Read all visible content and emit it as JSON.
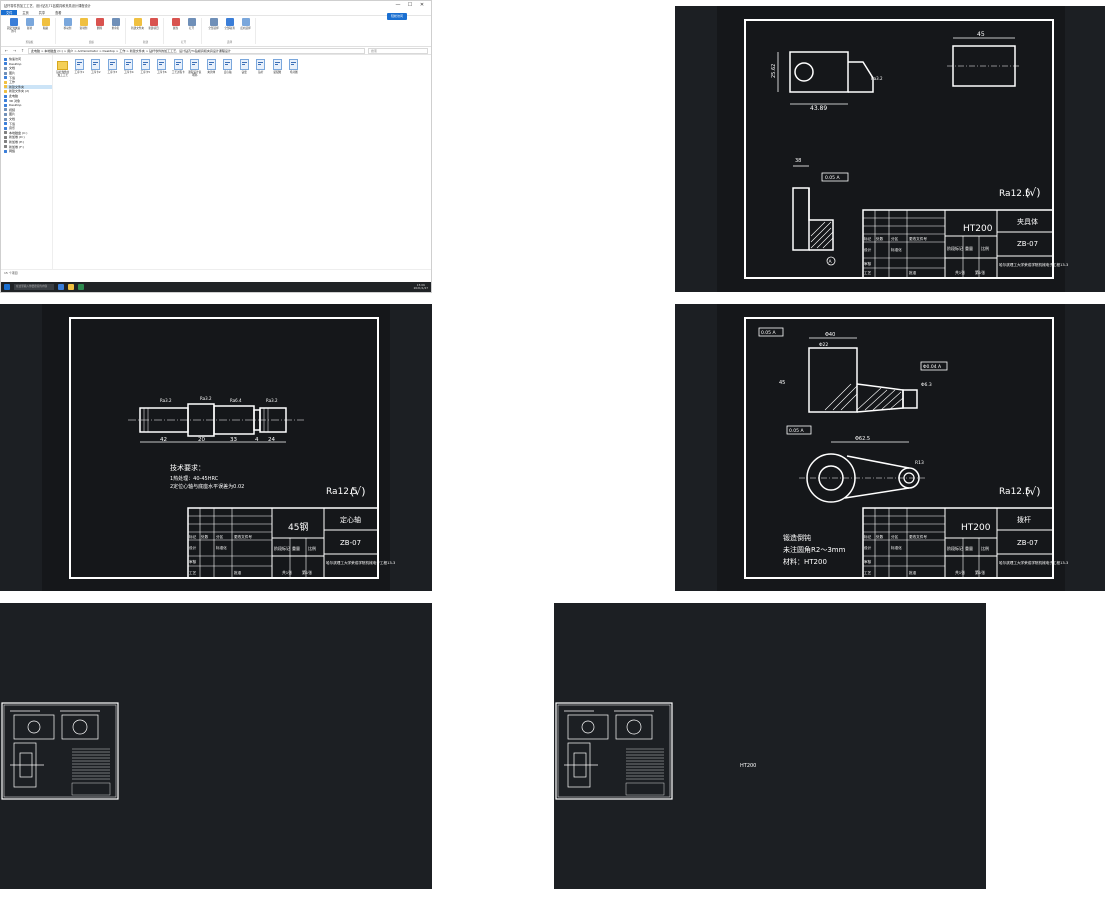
{
  "explorer": {
    "title": "钻杆零件的加工工艺、设计钻孔T1钻模具和夹具设计课程设计",
    "menus": [
      "文件",
      "主页",
      "共享",
      "查看"
    ],
    "window_buttons": [
      "—",
      "☐",
      "✕"
    ],
    "ribbon_groups": [
      {
        "label": "剪贴板",
        "items": [
          "固定到快速访问",
          "复制",
          "粘贴"
        ]
      },
      {
        "label": "组织",
        "items": [
          "移动到",
          "复制到",
          "删除",
          "重命名"
        ]
      },
      {
        "label": "新建",
        "items": [
          "新建文件夹",
          "新建项目"
        ]
      },
      {
        "label": "打开",
        "items": [
          "属性",
          "打开"
        ]
      },
      {
        "label": "选择",
        "items": [
          "全部选择",
          "全部取消",
          "反向选择"
        ]
      }
    ],
    "badge": "轻松访问",
    "address": "此电脑 > 本地磁盘 (C:) > 用户 > Administrator > Desktop > 工作 > 新建文件夹 > 钻杆零件的加工工艺、设计钻孔T1钻模具和夹具设计课程设计",
    "search_placeholder": "搜索",
    "nav_items": [
      {
        "label": "快速访问",
        "color": "#3b7ed8"
      },
      {
        "label": "Desktop",
        "color": "#3b7ed8"
      },
      {
        "label": "文档",
        "color": "#6f8fb8"
      },
      {
        "label": "图片",
        "color": "#6f8fb8"
      },
      {
        "label": "下载",
        "color": "#3b7ed8"
      },
      {
        "label": "工作",
        "color": "#f0c040"
      },
      {
        "label": "新建文件夹",
        "color": "#f0c040"
      },
      {
        "label": "新建文件夹 (2)",
        "color": "#f0c040"
      },
      {
        "label": "此电脑",
        "color": "#3b7ed8"
      },
      {
        "label": "3D 对象",
        "color": "#3b7ed8"
      },
      {
        "label": "Desktop",
        "color": "#3b7ed8"
      },
      {
        "label": "视频",
        "color": "#6f8fb8"
      },
      {
        "label": "图片",
        "color": "#6f8fb8"
      },
      {
        "label": "文档",
        "color": "#6f8fb8"
      },
      {
        "label": "下载",
        "color": "#3b7ed8"
      },
      {
        "label": "音乐",
        "color": "#3b7ed8"
      },
      {
        "label": "本地磁盘 (C:)",
        "color": "#7f7f7f"
      },
      {
        "label": "新加卷 (D:)",
        "color": "#7f7f7f"
      },
      {
        "label": "新加卷 (E:)",
        "color": "#7f7f7f"
      },
      {
        "label": "新加卷 (F:)",
        "color": "#7f7f7f"
      },
      {
        "label": "网络",
        "color": "#3b7ed8"
      }
    ],
    "files": [
      {
        "name": "钻杆零件的加工工艺",
        "type": "folder"
      },
      {
        "name": "工序卡1",
        "type": "doc"
      },
      {
        "name": "工序卡2",
        "type": "doc"
      },
      {
        "name": "工序卡3",
        "type": "doc"
      },
      {
        "name": "工序卡4",
        "type": "doc"
      },
      {
        "name": "工序卡5",
        "type": "doc"
      },
      {
        "name": "工序卡6",
        "type": "doc"
      },
      {
        "name": "工艺过程卡",
        "type": "doc"
      },
      {
        "name": "课程设计说明书",
        "type": "doc"
      },
      {
        "name": "夹具体",
        "type": "doc"
      },
      {
        "name": "定心轴",
        "type": "doc"
      },
      {
        "name": "钻套",
        "type": "doc"
      },
      {
        "name": "钻杆",
        "type": "doc"
      },
      {
        "name": "装配图",
        "type": "doc"
      },
      {
        "name": "毛坯图",
        "type": "doc"
      }
    ],
    "status": "15 个项目",
    "taskbar_search": "在这里输入你要搜索的内容",
    "time": "15:06",
    "date": "2021/1/27"
  },
  "cad1": {
    "dims": [
      "43.89",
      "25.62",
      "45",
      "38",
      "Ra3.2",
      "0.05 A",
      "A"
    ],
    "roughness": "Ra12.5",
    "check": "(√)",
    "material": "HT200",
    "part_name": "夹具体",
    "drawing_no": "ZB-07",
    "title_labels": [
      "标记",
      "处数",
      "分区",
      "更改文件号",
      "设计",
      "标准化",
      "阶段标记",
      "重量",
      "比例",
      "审核",
      "工艺",
      "批准",
      "共1张",
      "第1张"
    ],
    "school": "哈尔滨理工大学荣成学院机械电子工程13-3"
  },
  "cad2": {
    "dims": [
      "42",
      "20",
      "33",
      "4",
      "24",
      "Ra3.2",
      "Ra3.2",
      "Ra6.4",
      "Ra3.2"
    ],
    "tech_title": "技术要求：",
    "tech_lines": [
      "1热处理：40-45HRC",
      "2定位心轴与底座水平误差为0.02"
    ],
    "roughness": "Ra12.5",
    "check": "(√)",
    "material": "45钢",
    "part_name": "定心轴",
    "drawing_no": "ZB-07",
    "title_labels": [
      "标记",
      "处数",
      "分区",
      "更改文件号",
      "设计",
      "标准化",
      "阶段标记",
      "重量",
      "比例",
      "审核",
      "工艺",
      "批准",
      "共1张",
      "第1张"
    ],
    "school": "哈尔滨理工大学荣成学院机械电子工程13-3"
  },
  "cad3": {
    "dims": [
      "0.05 A",
      "Φ40",
      "Φ22",
      "45",
      "Φ6.3",
      "Φ0.04 A",
      "0.05 A",
      "R13",
      "Φ62.5"
    ],
    "notes": [
      "锻造倒钝",
      "未注圆角R2～3mm",
      "材料：HT200"
    ],
    "roughness": "Ra12.5",
    "check": "(√)",
    "material": "HT200",
    "part_name": "拨杆",
    "drawing_no": "ZB-07",
    "title_labels": [
      "标记",
      "处数",
      "分区",
      "更改文件号",
      "设计",
      "标准化",
      "阶段标记",
      "重量",
      "比例",
      "审核",
      "工艺",
      "批准",
      "共1张",
      "第1张"
    ],
    "school": "哈尔滨理工大学荣成学院机械电子工程13-3"
  },
  "cad5": {
    "label": "HT200"
  },
  "colors": {
    "cad_bg": "#1c1f23",
    "cad_line": "#ffffff",
    "accent": "#1a6fd1"
  }
}
